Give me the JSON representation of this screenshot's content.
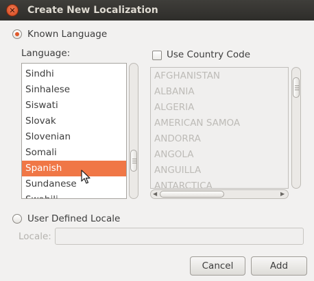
{
  "window": {
    "title": "Create New Localization"
  },
  "known_language": {
    "label": "Known Language",
    "checked": true
  },
  "language": {
    "label": "Language:",
    "items": [
      "Sindhi",
      "Sinhalese",
      "Siswati",
      "Slovak",
      "Slovenian",
      "Somali",
      "Spanish",
      "Sundanese",
      "Swahili"
    ],
    "selected": "Spanish"
  },
  "country": {
    "checkbox_label": "Use Country Code",
    "checked": false,
    "items": [
      "AFGHANISTAN",
      "ALBANIA",
      "ALGERIA",
      "AMERICAN SAMOA",
      "ANDORRA",
      "ANGOLA",
      "ANGUILLA",
      "ANTARCTICA"
    ]
  },
  "user_defined": {
    "label": "User Defined Locale",
    "checked": false
  },
  "locale": {
    "label": "Locale:",
    "value": ""
  },
  "buttons": {
    "cancel": "Cancel",
    "add": "Add"
  },
  "colors": {
    "selection": "#f07746",
    "titlebar": "#3a3935",
    "accent": "#e0582a"
  }
}
